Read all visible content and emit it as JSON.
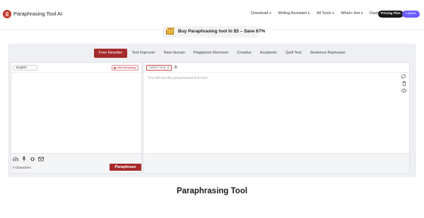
{
  "header": {
    "brand": "Paraphrasing Tool AI",
    "nav": [
      {
        "label": "Download",
        "caret": true
      },
      {
        "label": "Writing Assistant",
        "caret": true
      },
      {
        "label": "All Tools",
        "caret": true
      },
      {
        "label": "What's Hot",
        "caret": true
      },
      {
        "label": "Dashboard",
        "caret": false
      }
    ],
    "pricing_label": "Pricing Plan",
    "logout_label": "Logout"
  },
  "promo": {
    "badge": "SALE",
    "text": "Buy Paraphrasing tool In $5 – Save 67%"
  },
  "tabs": [
    {
      "label": "Free Rewriter",
      "active": true
    },
    {
      "label": "Text Improver",
      "active": false
    },
    {
      "label": "New Human",
      "active": false
    },
    {
      "label": "Plagiarism Remover",
      "active": false
    },
    {
      "label": "Creative",
      "active": false
    },
    {
      "label": "Academic",
      "active": false
    },
    {
      "label": "Quill Text",
      "active": false
    },
    {
      "label": "Sentence Rephraser",
      "active": false
    }
  ],
  "input_panel": {
    "language": "English",
    "web_browsing_label": "Web Browsing",
    "char_count": "0 Characters",
    "paraphrase_label": "Paraphrase"
  },
  "output_panel": {
    "tone_label": "Select Tone",
    "placeholder": "You will see the paraphrased text here"
  },
  "page_heading": "Paraphrasing Tool",
  "colors": {
    "accent": "#a52a2a",
    "logout": "#6b5bff",
    "pricing": "#1a1a1a"
  }
}
